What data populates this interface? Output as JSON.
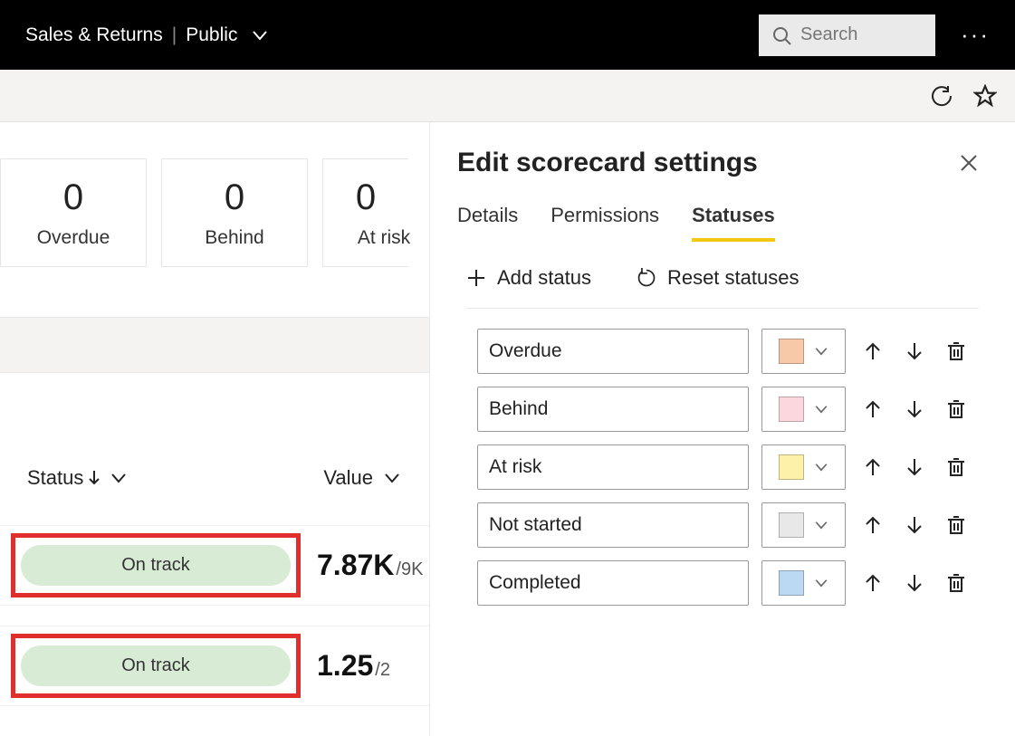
{
  "header": {
    "app_name": "Sales & Returns",
    "visibility": "Public",
    "search_placeholder": "Search"
  },
  "cards": [
    {
      "value": "0",
      "label": "Overdue"
    },
    {
      "value": "0",
      "label": "Behind"
    },
    {
      "value": "0",
      "label": "At risk"
    }
  ],
  "table": {
    "columns": {
      "status": "Status",
      "value": "Value"
    },
    "rows": [
      {
        "status": "On track",
        "value": "7.87K",
        "target": "/9K"
      },
      {
        "status": "On track",
        "value": "1.25",
        "target": "/2"
      }
    ]
  },
  "panel": {
    "title": "Edit scorecard settings",
    "tabs": {
      "details": "Details",
      "permissions": "Permissions",
      "statuses": "Statuses"
    },
    "actions": {
      "add": "Add status",
      "reset": "Reset statuses"
    },
    "statuses": [
      {
        "name": "Overdue",
        "color": "#f7c9a8",
        "can_up": false,
        "can_down": true
      },
      {
        "name": "Behind",
        "color": "#fcd7de",
        "can_up": true,
        "can_down": true
      },
      {
        "name": "At risk",
        "color": "#fdf0a9",
        "can_up": true,
        "can_down": true
      },
      {
        "name": "Not started",
        "color": "#e8e8e8",
        "can_up": true,
        "can_down": true
      },
      {
        "name": "Completed",
        "color": "#bcd9f4",
        "can_up": true,
        "can_down": false
      }
    ]
  }
}
